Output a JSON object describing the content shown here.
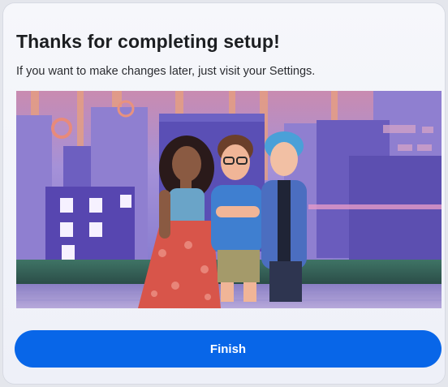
{
  "dialog": {
    "title": "Thanks for completing setup!",
    "subtitle": "If you want to make changes later, just visit your Settings.",
    "finish_label": "Finish"
  },
  "illustration": {
    "subject": "three cartoon avatars standing in front of a purple city skyline",
    "colors": {
      "sky": "#9a8fd8",
      "buildings": "#5b4fa8",
      "ground": "#3d6b5e",
      "accent": "#e88a7a"
    }
  },
  "colors": {
    "primary_button": "#0866e8",
    "title_text": "#1c1e21",
    "background": "#f6f7fb"
  }
}
